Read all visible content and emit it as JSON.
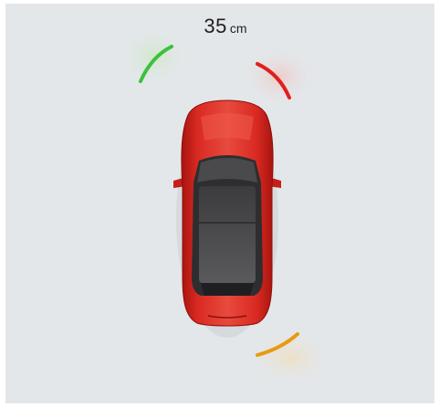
{
  "distance": {
    "value": "35",
    "unit": "cm"
  },
  "sensors": {
    "front_left": {
      "status": "clear",
      "color": "#3cc13c"
    },
    "front_right": {
      "status": "close",
      "color": "#e0201c"
    },
    "rear_right": {
      "status": "warning",
      "color": "#e89a14"
    }
  },
  "vehicle": {
    "view": "top-down",
    "body_color": "#d42a22"
  }
}
